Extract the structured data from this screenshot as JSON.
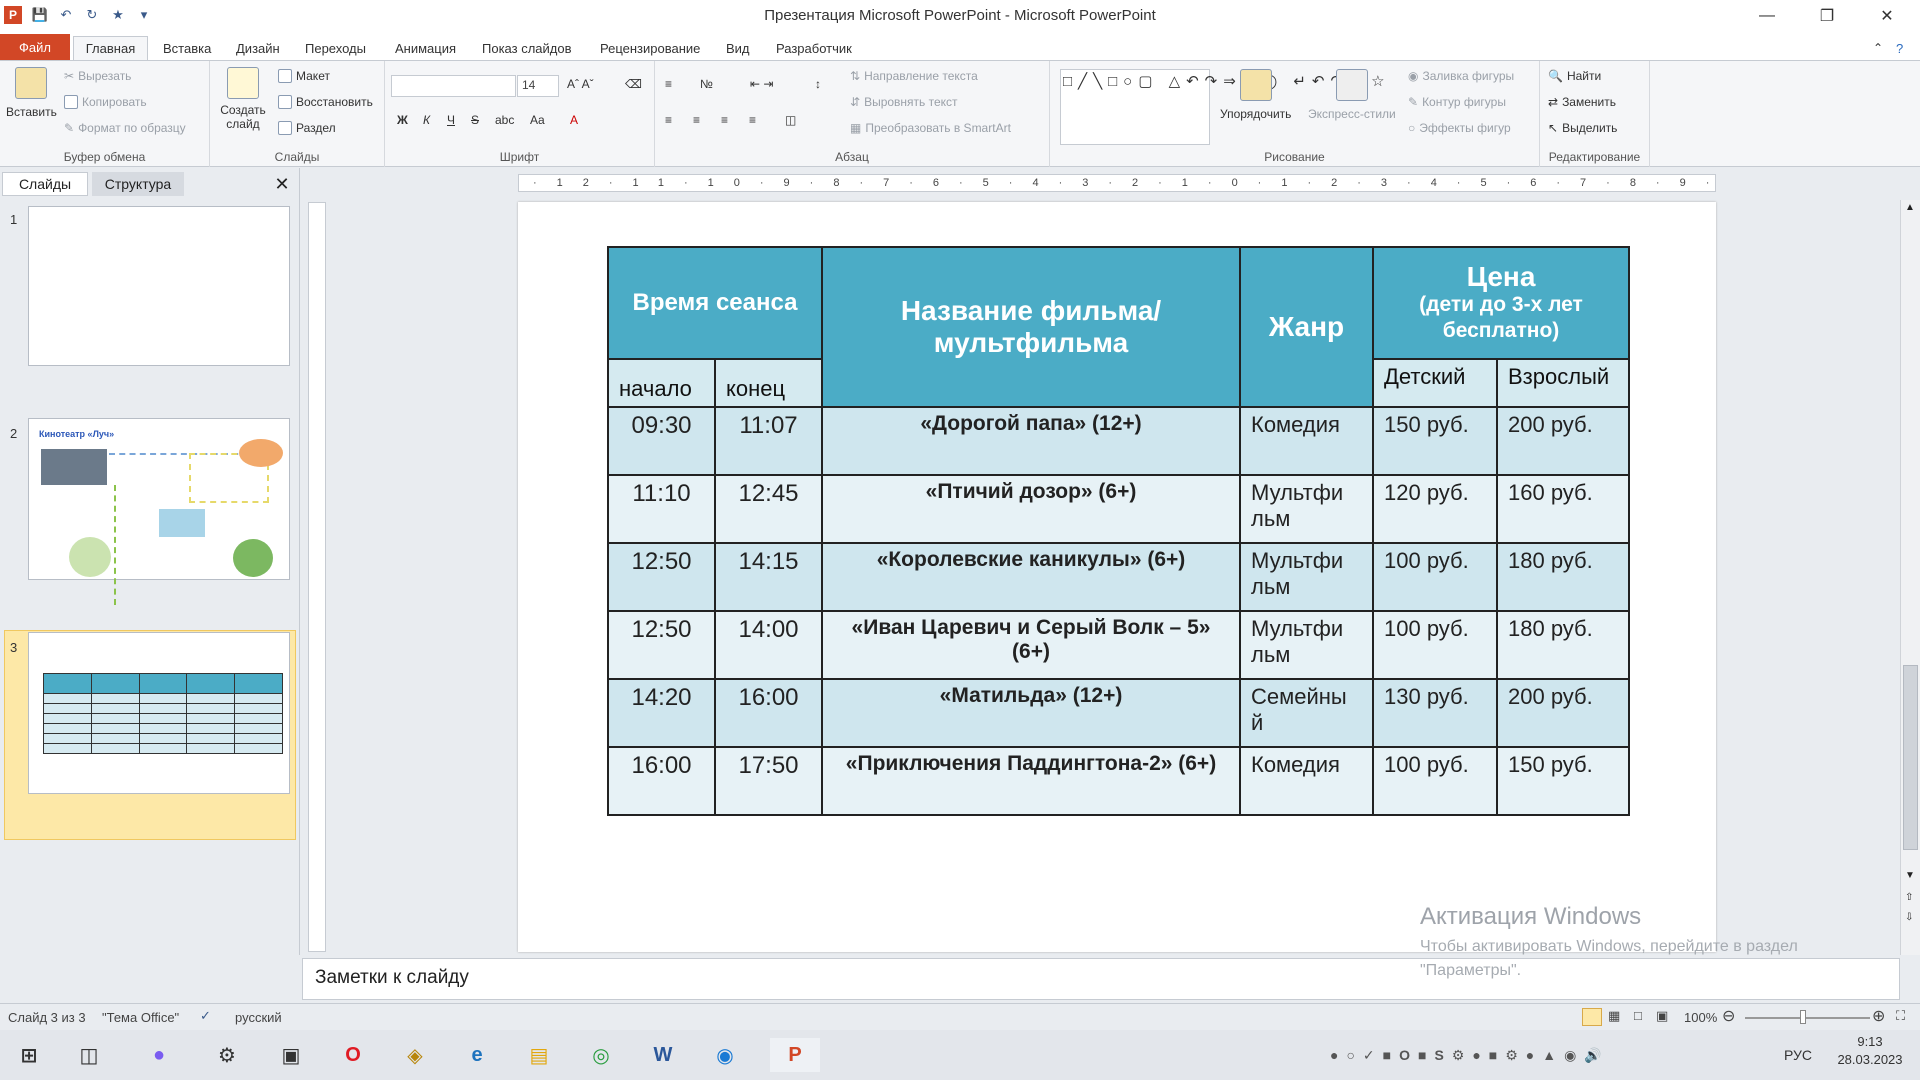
{
  "window": {
    "title": "Презентация Microsoft PowerPoint - Microsoft PowerPoint",
    "app_icon": "P",
    "controls": [
      "minimize-icon",
      "maximize-icon",
      "close-icon"
    ]
  },
  "ribbon_tabs": [
    "Файл",
    "Главная",
    "Вставка",
    "Дизайн",
    "Переходы",
    "Анимация",
    "Показ слайдов",
    "Рецензирование",
    "Вид",
    "Разработчик"
  ],
  "ribbon": {
    "clipboard": {
      "paste": "Вставить",
      "cut": "Вырезать",
      "copy": "Копировать",
      "format_painter": "Формат по образцу",
      "label": "Буфер обмена"
    },
    "slides": {
      "new_slide": "Создать слайд",
      "layout": "Макет",
      "reset": "Восстановить",
      "section": "Раздел",
      "label": "Слайды"
    },
    "font": {
      "size": "14",
      "label": "Шрифт",
      "bold": "Ж",
      "italic": "К",
      "underline": "Ч",
      "strike": "S"
    },
    "paragraph": {
      "text_direction": "Направление текста",
      "align_text": "Выровнять текст",
      "smartart": "Преобразовать в SmartArt",
      "label": "Абзац"
    },
    "drawing": {
      "arrange": "Упорядочить",
      "quick_styles": "Экспресс-стили",
      "fill": "Заливка фигуры",
      "outline": "Контур фигуры",
      "effects": "Эффекты фигур",
      "label": "Рисование"
    },
    "editing": {
      "find": "Найти",
      "replace": "Заменить",
      "select": "Выделить",
      "label": "Редактирование"
    }
  },
  "left_pane": {
    "tabs": [
      "Слайды",
      "Структура"
    ],
    "slides": [
      {
        "num": "1"
      },
      {
        "num": "2",
        "title": "Кинотеатр «Луч»"
      },
      {
        "num": "3"
      }
    ]
  },
  "slide": {
    "table": {
      "headers": {
        "time": "Время сеанса",
        "start": "начало",
        "end": "конец",
        "title": "Название фильма/мультфильма",
        "genre": "Жанр",
        "price": "Цена",
        "price_note": "(дети до 3-х лет бесплатно)",
        "child": "Детский",
        "adult": "Взрослый"
      },
      "rows": [
        {
          "start": "09:30",
          "end": "11:07",
          "title": "«Дорогой папа» (12+)",
          "genre": "Комедия",
          "child": "150 руб.",
          "adult": "200 руб."
        },
        {
          "start": "11:10",
          "end": "12:45",
          "title": "«Птичий дозор» (6+)",
          "genre": "Мультфи льм",
          "child": "120 руб.",
          "adult": "160 руб."
        },
        {
          "start": "12:50",
          "end": "14:15",
          "title": "«Королевские каникулы» (6+)",
          "genre": "Мультфи льм",
          "child": "100 руб.",
          "adult": "180 руб."
        },
        {
          "start": "12:50",
          "end": "14:00",
          "title": "«Иван Царевич и Серый Волк – 5» (6+)",
          "genre": "Мультфи льм",
          "child": "100 руб.",
          "adult": "180 руб."
        },
        {
          "start": "14:20",
          "end": "16:00",
          "title": "«Матильда» (12+)",
          "genre": "Семейны й",
          "child": "130 руб.",
          "adult": "200 руб."
        },
        {
          "start": "16:00",
          "end": "17:50",
          "title": "«Приключения Паддингтона-2» (6+)",
          "genre": "Комедия",
          "child": "100 руб.",
          "adult": "150 руб."
        }
      ]
    }
  },
  "notes_placeholder": "Заметки к слайду",
  "watermark": {
    "title": "Активация Windows",
    "line1": "Чтобы активировать Windows, перейдите в раздел",
    "line2": "\"Параметры\"."
  },
  "status": {
    "slide_info": "Слайд 3 из 3",
    "theme": "\"Тема Office\"",
    "language": "русский",
    "zoom": "100%"
  },
  "taskbar": {
    "lang": "РУС",
    "time": "9:13",
    "date": "28.03.2023"
  },
  "colors": {
    "accent": "#d24726",
    "table_header": "#4bacc6",
    "row_dark": "#cfe6ee",
    "row_light": "#e7f2f6"
  }
}
